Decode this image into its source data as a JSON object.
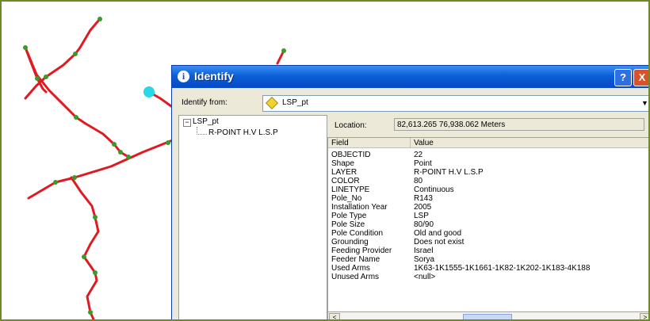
{
  "dialog": {
    "title": "Identify",
    "help_button": "?",
    "close_button": "X",
    "identify_from_label": "Identify from:",
    "identify_from_value": "LSP_pt",
    "location_label": "Location:",
    "location_value": "82,613.265  76,938.062 Meters"
  },
  "tree": {
    "expander": "−",
    "layer": "LSP_pt",
    "feature": "R-POINT H.V L.S.P"
  },
  "table": {
    "headers": [
      "Field",
      "Value"
    ],
    "rows": [
      {
        "field": "OBJECTID",
        "value": "22"
      },
      {
        "field": "Shape",
        "value": "Point"
      },
      {
        "field": "LAYER",
        "value": "R-POINT H.V L.S.P"
      },
      {
        "field": "COLOR",
        "value": "80"
      },
      {
        "field": "LINETYPE",
        "value": "Continuous"
      },
      {
        "field": "Pole_No",
        "value": "R143"
      },
      {
        "field": "Installation Year",
        "value": "2005"
      },
      {
        "field": "Pole Type",
        "value": "LSP"
      },
      {
        "field": "Pole Size",
        "value": "80/90"
      },
      {
        "field": "Pole Condition",
        "value": "Old and good"
      },
      {
        "field": "Grounding",
        "value": "Does not exist"
      },
      {
        "field": "Feeding Provider",
        "value": "Israel"
      },
      {
        "field": "Feeder Name",
        "value": "Sorya"
      },
      {
        "field": "Used Arms",
        "value": "1K63-1K1555-1K1661-1K82-1K202-1K183-4K188"
      },
      {
        "field": "Unused Arms",
        "value": "<null>"
      }
    ]
  },
  "scroll": {
    "left": "<",
    "right": ">"
  },
  "colors": {
    "line": "#e01a22",
    "vertex": "#3a9a2a",
    "selected_point": "#29d7e8",
    "frame": "#6e8a28",
    "titlebar": "#0a5fd8"
  },
  "icons": {
    "title": "info-icon",
    "layer": "layer-diamond-icon",
    "dropdown": "chevron-down-icon"
  }
}
